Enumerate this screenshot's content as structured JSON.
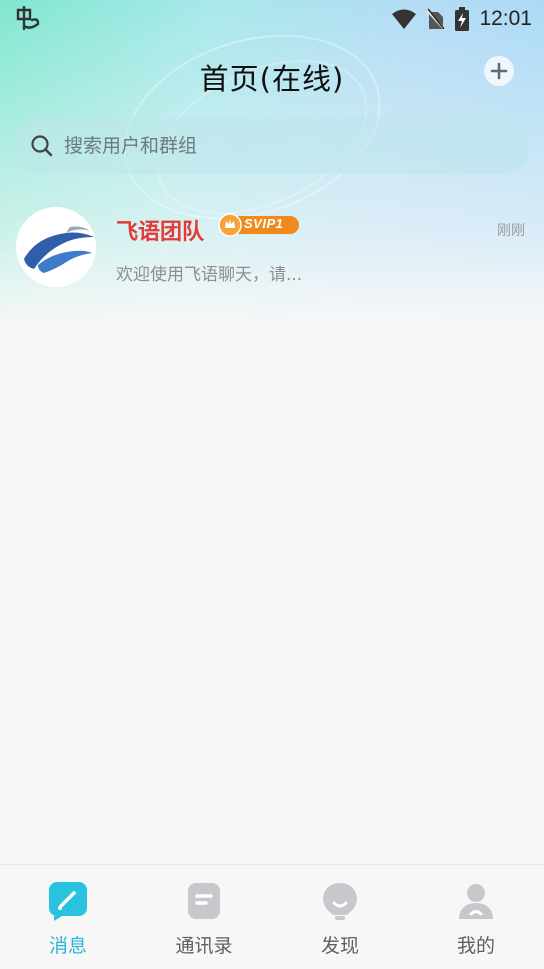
{
  "status_bar": {
    "time": "12:01"
  },
  "header": {
    "title": "首页(在线)"
  },
  "search": {
    "placeholder": "搜索用户和群组"
  },
  "conversations": [
    {
      "name": "飞语团队",
      "badge": "SVIP1",
      "time": "刚刚",
      "preview": "欢迎使用飞语聊天，请..."
    }
  ],
  "tabs": [
    {
      "label": "消息",
      "active": true
    },
    {
      "label": "通讯录",
      "active": false
    },
    {
      "label": "发现",
      "active": false
    },
    {
      "label": "我的",
      "active": false
    }
  ],
  "colors": {
    "accent": "#29b6d6",
    "name_red": "#e53935",
    "badge_orange": "#f08a1c"
  }
}
